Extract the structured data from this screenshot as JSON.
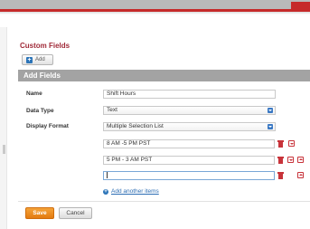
{
  "section": {
    "title": "Custom Fields"
  },
  "toolbar": {
    "add_label": "Add"
  },
  "panel": {
    "header": "Add Fields"
  },
  "form": {
    "name_label": "Name",
    "name_value": "Shift Hours",
    "data_type_label": "Data Type",
    "data_type_value": "Text",
    "display_format_label": "Display Format",
    "display_format_value": "Multiple Selection List"
  },
  "options": [
    "8 AM -5 PM PST",
    "5 PM - 3 AM PST",
    ""
  ],
  "add_another_label": "Add another items",
  "buttons": {
    "save": "Save",
    "cancel": "Cancel"
  },
  "colors": {
    "accent_red": "#c62a2a",
    "title_red": "#a02a38",
    "link_blue": "#2b6cb3",
    "save_orange": "#e37b10"
  },
  "icons": {
    "add": "plus-icon",
    "delete": "trash-icon",
    "move_down": "chevron-down-icon",
    "move_up": "chevron-up-icon",
    "select": "dropdown-arrow-icon"
  }
}
